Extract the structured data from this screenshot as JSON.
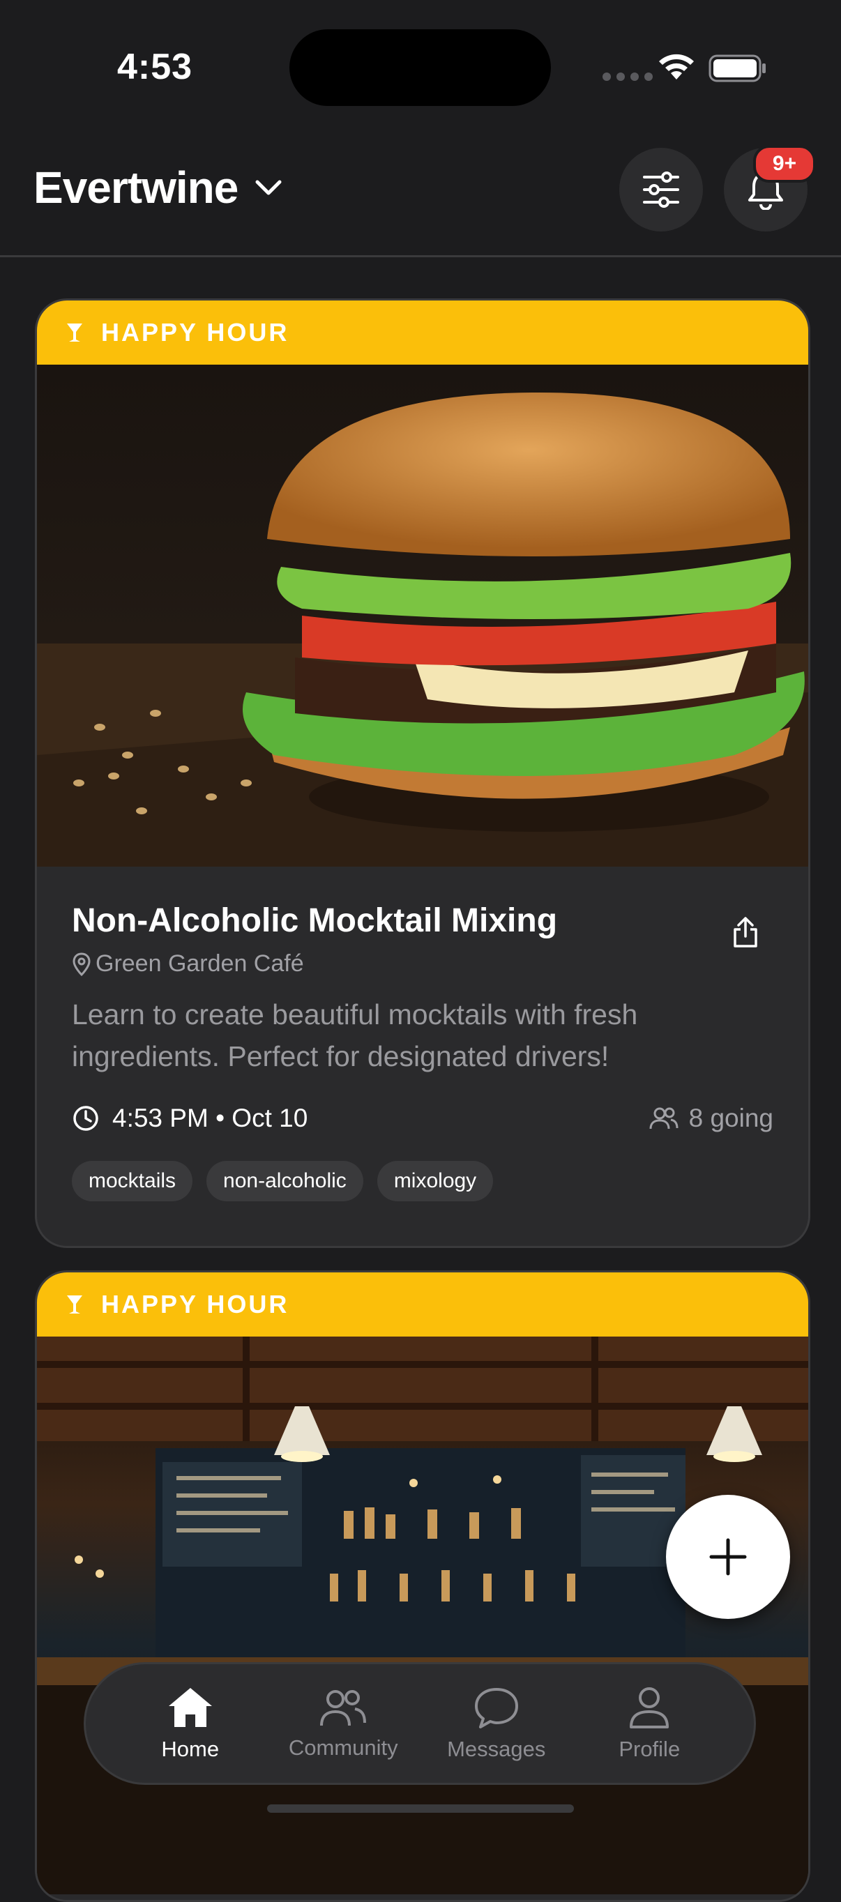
{
  "status_bar": {
    "time": "4:53"
  },
  "header": {
    "title": "Evertwine",
    "notification_badge": "9+"
  },
  "feed": [
    {
      "category": "HAPPY HOUR",
      "category_color": "#fbbf0a",
      "image": "burger-photo",
      "title": "Non-Alcoholic Mocktail Mixing",
      "location": "Green Garden Café",
      "description": "Learn to create beautiful mocktails with fresh ingredients. Perfect for designated drivers!",
      "time": "4:53 PM • Oct 10",
      "attendees": "8 going",
      "tags": [
        "mocktails",
        "non-alcoholic",
        "mixology"
      ]
    },
    {
      "category": "HAPPY HOUR",
      "category_color": "#fbbf0a",
      "image": "bar-interior-photo"
    }
  ],
  "tab_bar": {
    "items": [
      {
        "label": "Home",
        "icon": "home-icon",
        "active": true
      },
      {
        "label": "Community",
        "icon": "community-icon",
        "active": false
      },
      {
        "label": "Messages",
        "icon": "messages-icon",
        "active": false
      },
      {
        "label": "Profile",
        "icon": "profile-icon",
        "active": false
      }
    ]
  },
  "colors": {
    "background": "#1c1c1e",
    "card": "#2a2a2c",
    "accent": "#fbbf0a",
    "badge": "#e53935"
  }
}
